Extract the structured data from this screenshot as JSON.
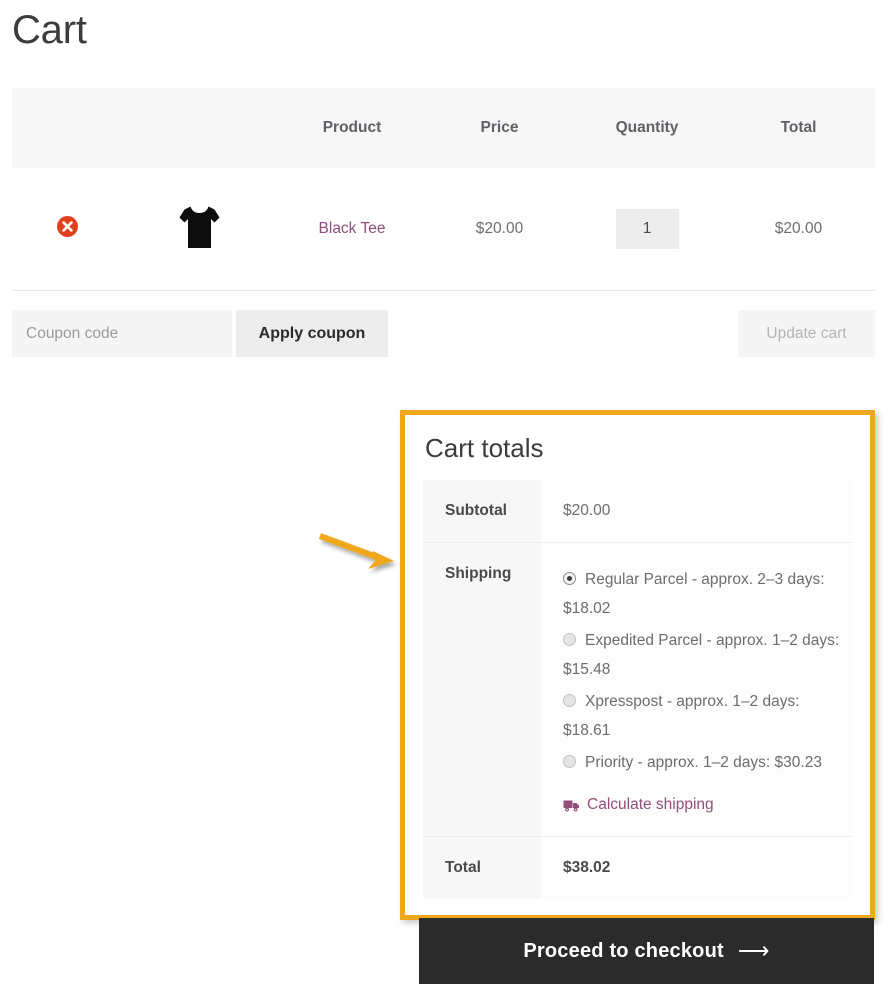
{
  "page": {
    "title": "Cart"
  },
  "cart_table": {
    "headers": {
      "remove": "",
      "thumbnail": "",
      "product": "Product",
      "price": "Price",
      "quantity": "Quantity",
      "total": "Total"
    },
    "rows": [
      {
        "remove_icon": "remove-circle-x-icon",
        "thumbnail_icon": "black-tshirt-thumbnail",
        "product_name": "Black Tee",
        "price": "$20.00",
        "quantity": "1",
        "total": "$20.00"
      }
    ]
  },
  "actions": {
    "coupon_placeholder": "Coupon code",
    "coupon_value": "",
    "apply_coupon_label": "Apply coupon",
    "update_cart_label": "Update cart"
  },
  "cart_totals": {
    "heading": "Cart totals",
    "subtotal_label": "Subtotal",
    "subtotal_value": "$20.00",
    "shipping_label": "Shipping",
    "shipping_options": [
      {
        "label": "Regular Parcel - approx. 2–3 days: $18.02",
        "selected": true
      },
      {
        "label": "Expedited Parcel - approx. 1–2 days: $15.48",
        "selected": false
      },
      {
        "label": "Xpresspost - approx. 1–2 days: $18.61",
        "selected": false
      },
      {
        "label": "Priority - approx. 1–2 days: $30.23",
        "selected": false
      }
    ],
    "calculate_shipping_label": "Calculate shipping",
    "calculate_shipping_icon": "truck-icon",
    "total_label": "Total",
    "total_value": "$38.02"
  },
  "checkout": {
    "label": "Proceed to checkout",
    "arrow": "⟶"
  },
  "colors": {
    "highlight_border": "#efa81d",
    "annotation_arrow": "#efa81d",
    "link": "#8f4f7a",
    "remove_icon": "#e2401c",
    "checkout_bg": "#2b2b2b",
    "header_bg": "#f7f7f7"
  }
}
